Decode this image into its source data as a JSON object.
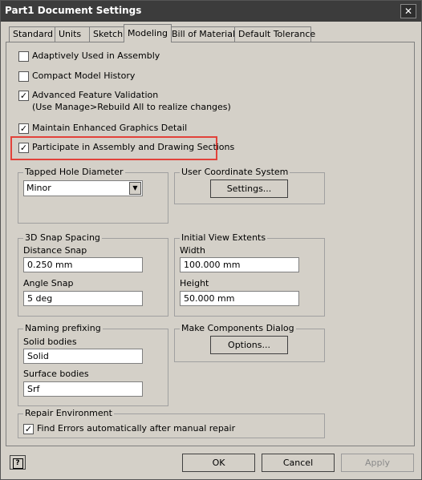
{
  "window": {
    "title": "Part1 Document Settings",
    "close_glyph": "✕"
  },
  "tabs": [
    {
      "label": "Standard"
    },
    {
      "label": "Units"
    },
    {
      "label": "Sketch"
    },
    {
      "label": "Modeling"
    },
    {
      "label": "Bill of Materials"
    },
    {
      "label": "Default Tolerance"
    }
  ],
  "active_tab": "Modeling",
  "checkboxes": [
    {
      "label": "Adaptively Used in Assembly",
      "checked": false
    },
    {
      "label": "Compact Model History",
      "checked": false
    },
    {
      "label": "Advanced Feature Validation",
      "sublabel": "(Use Manage>Rebuild All to realize changes)",
      "checked": true
    },
    {
      "label": "Maintain Enhanced Graphics Detail",
      "checked": true
    },
    {
      "label": "Participate in Assembly and Drawing Sections",
      "checked": true
    }
  ],
  "check_glyph": "✓",
  "highlight_color": "#e2423a",
  "tapped_hole": {
    "legend": "Tapped Hole Diameter",
    "selected": "Minor"
  },
  "ucs": {
    "legend": "User Coordinate System",
    "button_label": "Settings..."
  },
  "snap": {
    "legend": "3D Snap Spacing",
    "distance_label": "Distance Snap",
    "distance_value": "0.250 mm",
    "angle_label": "Angle Snap",
    "angle_value": "5 deg"
  },
  "view_extents": {
    "legend": "Initial View Extents",
    "width_label": "Width",
    "width_value": "100.000 mm",
    "height_label": "Height",
    "height_value": "50.000 mm"
  },
  "naming": {
    "legend": "Naming prefixing",
    "solid_label": "Solid bodies",
    "solid_value": "Solid",
    "surface_label": "Surface bodies",
    "surface_value": "Srf"
  },
  "components_dialog": {
    "legend": "Make Components Dialog",
    "button_label": "Options..."
  },
  "repair": {
    "legend": "Repair Environment",
    "checkbox_label": "Find Errors automatically after manual repair",
    "checked": true
  },
  "footer": {
    "help_glyph": "?",
    "ok_label": "OK",
    "cancel_label": "Cancel",
    "apply_label": "Apply"
  }
}
